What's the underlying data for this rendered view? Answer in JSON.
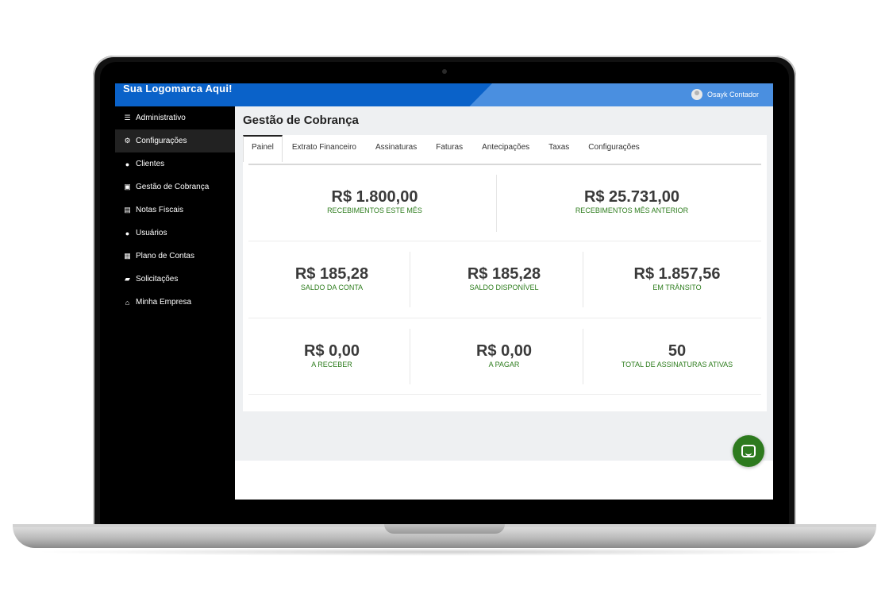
{
  "header": {
    "logo_text": "Sua Logomarca Aqui!",
    "user_name": "Osayk Contador"
  },
  "sidebar": {
    "items": [
      {
        "label": "Administrativo",
        "icon": "menu-icon"
      },
      {
        "label": "Configurações",
        "icon": "gears-icon"
      },
      {
        "label": "Clientes",
        "icon": "user-icon"
      },
      {
        "label": "Gestão de Cobrança",
        "icon": "money-icon"
      },
      {
        "label": "Notas Fiscais",
        "icon": "document-icon"
      },
      {
        "label": "Usuários",
        "icon": "users-icon"
      },
      {
        "label": "Plano de Contas",
        "icon": "calculator-icon"
      },
      {
        "label": "Solicitações",
        "icon": "chat-icon"
      },
      {
        "label": "Minha Empresa",
        "icon": "home-icon"
      }
    ]
  },
  "main": {
    "title": "Gestão de Cobrança",
    "tabs": [
      "Painel",
      "Extrato Financeiro",
      "Assinaturas",
      "Faturas",
      "Antecipações",
      "Taxas",
      "Configurações"
    ],
    "active_tab": "Painel",
    "stats": {
      "received_this_month": {
        "value": "R$ 1.800,00",
        "label": "RECEBIMENTOS ESTE MÊS"
      },
      "received_last_month": {
        "value": "R$ 25.731,00",
        "label": "RECEBIMENTOS MÊS ANTERIOR"
      },
      "account_balance": {
        "value": "R$ 185,28",
        "label": "SALDO DA CONTA"
      },
      "available_balance": {
        "value": "R$ 185,28",
        "label": "SALDO DISPONÍVEL"
      },
      "in_transit": {
        "value": "R$ 1.857,56",
        "label": "EM TRÂNSITO"
      },
      "receivable": {
        "value": "R$ 0,00",
        "label": "A RECEBER"
      },
      "payable": {
        "value": "R$ 0,00",
        "label": "A PAGAR"
      },
      "active_subscriptions": {
        "value": "50",
        "label": "TOTAL DE ASSINATURAS ATIVAS"
      }
    }
  },
  "colors": {
    "topbar_dark": "#0a62c9",
    "topbar_light": "#4a8fe0",
    "accent_green": "#2e7d1e",
    "chat_button": "#2d7a1e"
  }
}
